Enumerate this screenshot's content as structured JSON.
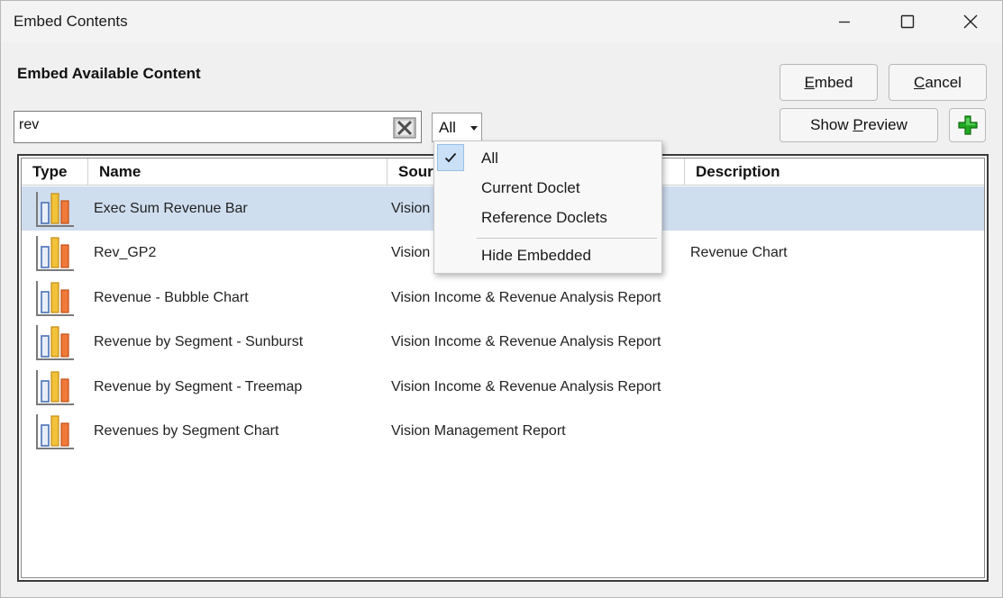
{
  "window": {
    "title": "Embed Contents"
  },
  "heading": "Embed Available Content",
  "buttons": {
    "embed": {
      "first": "E",
      "rest": "mbed"
    },
    "cancel": {
      "first": "C",
      "rest": "ancel"
    },
    "show_preview": {
      "before": "Show ",
      "ul": "P",
      "after": "review"
    }
  },
  "search": {
    "value": "rev"
  },
  "filter": {
    "selected": "All",
    "options": [
      "All",
      "Current Doclet",
      "Reference Doclets",
      "Hide Embedded"
    ]
  },
  "columns": [
    "Type",
    "Name",
    "Source",
    "Description"
  ],
  "columns_visible": [
    "Type",
    "Name",
    "Sour",
    "Description"
  ],
  "rows": [
    {
      "name": "Exec Sum Revenue Bar",
      "source": "Vision",
      "description": "",
      "selected": true
    },
    {
      "name": "Rev_GP2",
      "source": "Vision",
      "description": "Revenue Chart",
      "selected": false
    },
    {
      "name": "Revenue - Bubble Chart",
      "source": "Vision Income & Revenue Analysis Report",
      "description": "",
      "selected": false
    },
    {
      "name": "Revenue by Segment - Sunburst",
      "source": "Vision Income & Revenue Analysis Report",
      "description": "",
      "selected": false
    },
    {
      "name": "Revenue by Segment - Treemap",
      "source": "Vision Income & Revenue Analysis Report",
      "description": "",
      "selected": false
    },
    {
      "name": "Revenues by Segment Chart",
      "source": "Vision Management Report",
      "description": "",
      "selected": false
    }
  ],
  "icons": {
    "row_type": "bar-chart-icon",
    "add": "plus-icon",
    "clear": "clear-search-icon",
    "check": "check-icon"
  },
  "colors": {
    "selection": "#cfdeef",
    "add_green": "#1a9a1a"
  }
}
